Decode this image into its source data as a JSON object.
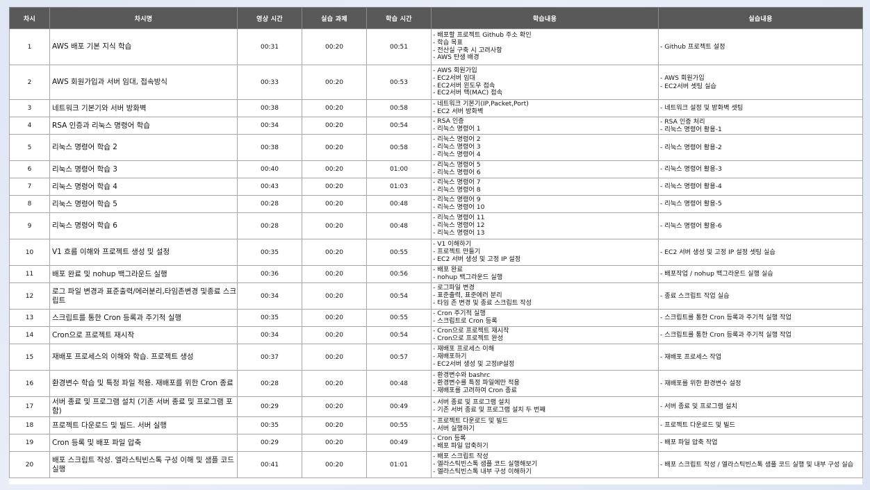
{
  "table": {
    "headers": [
      "차시",
      "차시명",
      "영상 시간",
      "실습 과제",
      "학습 시간",
      "학습내용",
      "실습내용"
    ],
    "rows": [
      {
        "no": "1",
        "title": "AWS 배포 기본 지식 학습",
        "video": "00:31",
        "task": "00:20",
        "study": "00:51",
        "contents": [
          "- 배포할 프로젝트 Github 주소 확인",
          "- 학습 목표",
          "- 전산실 구축 시 고려사항",
          "- AWS 탄생 배경"
        ],
        "practice": [
          "- Github 프로젝트 설정"
        ]
      },
      {
        "no": "2",
        "title": "AWS 회원가입과 서버 임대, 접속방식",
        "video": "00:33",
        "task": "00:20",
        "study": "00:53",
        "contents": [
          "- AWS 회원가입",
          "- EC2서버 임대",
          "- EC2서버 윈도우 접속",
          "- EC2서버 맥(MAC) 접속"
        ],
        "practice": [
          "- AWS 회원가입",
          "- EC2서버 셋팅 실습"
        ]
      },
      {
        "no": "3",
        "title": "네트워크 기본기와 서버 방화벽",
        "video": "00:38",
        "task": "00:20",
        "study": "00:58",
        "contents": [
          "- 네트워크 기본기(IP,Packet,Port)",
          "- EC2 서버 방화벽"
        ],
        "practice": [
          "- 네트워크 설정 및 방화벽 셋팅"
        ]
      },
      {
        "no": "4",
        "title": "RSA 인증과 리눅스 명령어 학습",
        "video": "00:34",
        "task": "00:20",
        "study": "00:54",
        "contents": [
          "- RSA 인증",
          "- 리눅스 명령어 1"
        ],
        "practice": [
          "- RSA 인증 처리",
          "- 리눅스 명령어 활용-1"
        ]
      },
      {
        "no": "5",
        "title": "리눅스 명령어 학습 2",
        "video": "00:38",
        "task": "00:20",
        "study": "00:58",
        "contents": [
          "- 리눅스 명령어 2",
          "- 리눅스 명령어 3",
          "- 리눅스 명령어 4"
        ],
        "practice": [
          "- 리눅스 명령어 활용-2"
        ]
      },
      {
        "no": "6",
        "title": "리눅스 명령어 학습 3",
        "video": "00:40",
        "task": "00:20",
        "study": "01:00",
        "contents": [
          "- 리눅스 명령어 5",
          "- 리눅스 명령어 6"
        ],
        "practice": [
          "- 리눅스 명령어 활용-3"
        ]
      },
      {
        "no": "7",
        "title": "리눅스 명령어 학습 4",
        "video": "00:43",
        "task": "00:20",
        "study": "01:03",
        "contents": [
          "- 리눅스 명령어 7",
          "- 리눅스 명령어 8"
        ],
        "practice": [
          "- 리눅스 명령어 활용-4"
        ]
      },
      {
        "no": "8",
        "title": "리눅스 명령어 학습 5",
        "video": "00:28",
        "task": "00:20",
        "study": "00:48",
        "contents": [
          "- 리눅스 명령어 9",
          "- 리눅스 명령어 10"
        ],
        "practice": [
          "- 리눅스 명령어 활용-5"
        ]
      },
      {
        "no": "9",
        "title": "리눅스 명령어 학습 6",
        "video": "00:28",
        "task": "00:20",
        "study": "00:48",
        "contents": [
          "- 리눅스 명령어 11",
          "- 리눅스 명령어 12",
          "- 리눅스 명령어 13"
        ],
        "practice": [
          "- 리눅스 명령어 활용-6"
        ]
      },
      {
        "no": "10",
        "title": "V1 흐름 이해와 프로젝트 생성 및 설정",
        "video": "00:35",
        "task": "00:20",
        "study": "00:55",
        "contents": [
          "- V1 이해하기",
          "- 프로젝트 만들기",
          "- EC2 서버 생성 및 고정 IP 설정"
        ],
        "practice": [
          "- EC2 서버 생성 및 고정 IP 설정 셋팅 실습"
        ]
      },
      {
        "no": "11",
        "title": "배포 완료 및 nohup 백그라운드 실행",
        "video": "00:36",
        "task": "00:20",
        "study": "00:56",
        "contents": [
          "- 배포 완료",
          "- nohup 백그라운드 실행"
        ],
        "practice": [
          "- 배포작업 / nohup 백그라운드 실행 실습"
        ]
      },
      {
        "no": "12",
        "title": "로그 파일 변경과 표준출력/에러분리,타임존변경 및종료 스크립트",
        "video": "00:34",
        "task": "00:20",
        "study": "00:54",
        "contents": [
          "- 로그파일 변경",
          "- 표준출력, 표준에러 분리",
          "- 타임 존 변경 및 종료 스크립트 작성"
        ],
        "practice": [
          "- 종료 스크립트 작업 실습"
        ]
      },
      {
        "no": "13",
        "title": "스크립트를 통한 Cron 등록과 주기적 실행",
        "video": "00:35",
        "task": "00:20",
        "study": "00:55",
        "contents": [
          "- Cron 주기적 실행",
          "- 스크립트로 Cron 등록"
        ],
        "practice": [
          "- 스크립트를 통한 Cron 등록과 주기적 실행 작업"
        ]
      },
      {
        "no": "14",
        "title": "Cron으로 프로젝트 재시작",
        "video": "00:34",
        "task": "00:20",
        "study": "00:54",
        "contents": [
          "- Cron으로 프로젝트 재시작",
          "- Cron으로 프로젝트 완성"
        ],
        "practice": [
          "- 스크립트를 통한 Cron 등록과 주기적 실행 작업"
        ]
      },
      {
        "no": "15",
        "title": "재배포 프로세스의 이해와 학습. 프로젝트 생성",
        "video": "00:37",
        "task": "00:20",
        "study": "00:57",
        "contents": [
          "- 재배포 프로세스 이해",
          "- 재배포하기",
          "- EC2서버 생성 및 고정IP설정"
        ],
        "practice": [
          "- 재배포 프로세스 작업"
        ]
      },
      {
        "no": "16",
        "title": "환경변수 학습 및 특정 파일 적용. 재배포를 위한 Cron 종료",
        "video": "00:28",
        "task": "00:20",
        "study": "00:48",
        "contents": [
          "- 환경변수와 bashrc",
          "- 환경변수를 특정 파일에만 적용",
          "- 재배포를 고려하여 Cron 종료"
        ],
        "practice": [
          "- 재배포를 위한 환경변수 설정"
        ]
      },
      {
        "no": "17",
        "title": "서버 종료 및 프로그램 설치 (기존 서버 종료 및 프로그램 포함)",
        "video": "00:29",
        "task": "00:20",
        "study": "00:49",
        "contents": [
          "- 서버 종료 및 프로그램 설치",
          "- 기존 서버 종료 및 프로그램 설치 두 번째"
        ],
        "practice": [
          "- 서버 종료 및 프로그램 설치"
        ]
      },
      {
        "no": "18",
        "title": "프로젝트 다운로드 및 빌드. 서버 실행",
        "video": "00:35",
        "task": "00:20",
        "study": "00:55",
        "contents": [
          "- 프로젝트 다운로드 및 빌드",
          "- 서버 실행하기"
        ],
        "practice": [
          "- 프로젝트 다운로드 및 빌드"
        ]
      },
      {
        "no": "19",
        "title": "Cron 등록 및 배포 파일 압축",
        "video": "00:29",
        "task": "00:20",
        "study": "00:49",
        "contents": [
          "- Cron 등록",
          "- 배포 파일 압축하기"
        ],
        "practice": [
          "- 배포 파일 압축 작업"
        ]
      },
      {
        "no": "20",
        "title": "배포 스크립트 작성. 엘라스틱빈스톡 구성 이해 및 샘플 코드 실행",
        "video": "00:41",
        "task": "00:20",
        "study": "01:01",
        "contents": [
          "- 배포 스크립트 작성",
          "- 엘라스틱빈스톡 샘플 코드 실행해보기",
          "- 엘라스틱빈스톡 내부 구성 이해하기"
        ],
        "practice": [
          "- 배포 스크립트 작성 / 엘라스틱빈스톡 샘플 코드 실행 및 내부 구성 실습"
        ]
      }
    ]
  }
}
